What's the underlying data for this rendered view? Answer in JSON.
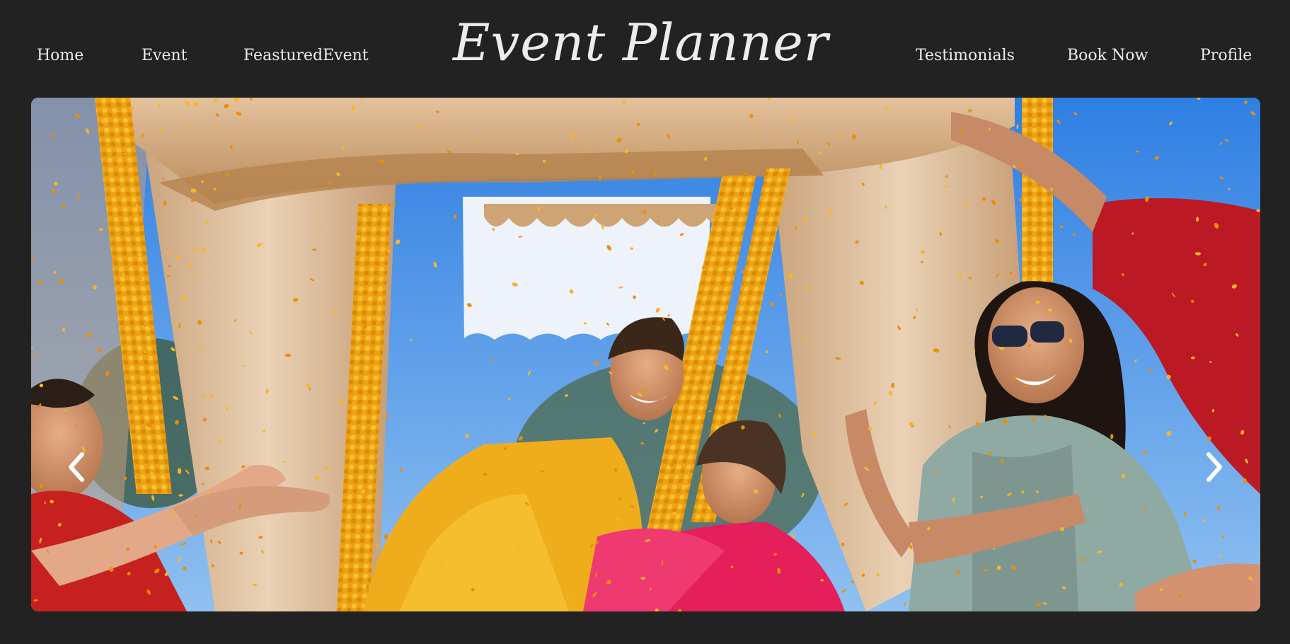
{
  "nav": {
    "left": [
      {
        "label": "Home"
      },
      {
        "label": "Event"
      },
      {
        "label": "FeasturedEvent"
      }
    ],
    "right": [
      {
        "label": "Testimonials"
      },
      {
        "label": "Book Now"
      },
      {
        "label": "Profile"
      }
    ]
  },
  "brand": {
    "title": "Event Planner"
  },
  "carousel": {
    "slide_image": "haldi-celebration-photo",
    "prev_icon": "chevron-left-icon",
    "next_icon": "chevron-right-icon"
  },
  "colors": {
    "background": "#222222",
    "text": "#ececec",
    "marigold": "#f2a515",
    "sky": "#3d8ae6",
    "canopy": "#d7b48a"
  }
}
